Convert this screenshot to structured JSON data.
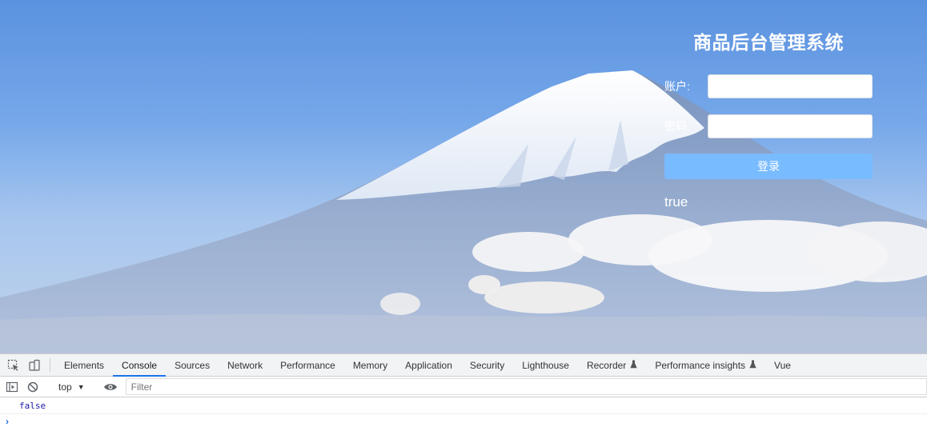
{
  "login": {
    "title": "商品后台管理系统",
    "account_label": "账户:",
    "account_value": "",
    "password_label": "密码:",
    "password_value": "",
    "submit_label": "登录",
    "result_text": "true"
  },
  "devtools": {
    "tabs": [
      {
        "label": "Elements"
      },
      {
        "label": "Console",
        "active": true
      },
      {
        "label": "Sources"
      },
      {
        "label": "Network"
      },
      {
        "label": "Performance"
      },
      {
        "label": "Memory"
      },
      {
        "label": "Application"
      },
      {
        "label": "Security"
      },
      {
        "label": "Lighthouse"
      },
      {
        "label": "Recorder",
        "experimental": true
      },
      {
        "label": "Performance insights",
        "experimental": true
      },
      {
        "label": "Vue"
      }
    ],
    "context_label": "top",
    "filter_placeholder": "Filter",
    "console_output": "false",
    "prompt_symbol": "›"
  },
  "icons": {
    "inspect": "inspect-element-icon",
    "device": "device-toolbar-icon",
    "sidebar": "console-sidebar-icon",
    "clear": "clear-console-icon",
    "eye": "live-expression-icon",
    "flask": "flask-icon"
  },
  "colors": {
    "accent": "#1a73e8",
    "login_button": "#79bbff",
    "console_value": "#1a1aa6"
  }
}
